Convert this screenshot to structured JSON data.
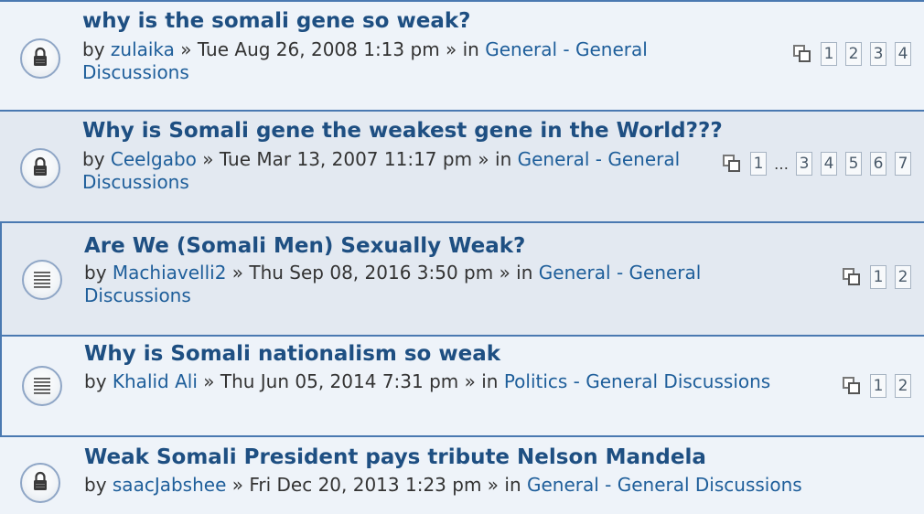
{
  "topics": [
    {
      "title": "why is the somali gene so weak?",
      "by": "by",
      "author": "zulaika",
      "date": "» Tue Aug 26, 2008 1:13 pm » in",
      "forum": "General - General Discussions",
      "icon": "lock-icon",
      "pages": [
        "1",
        "2",
        "3",
        "4"
      ]
    },
    {
      "title": "Why is Somali gene the weakest gene in the World???",
      "by": "by",
      "author": "Ceelgabo",
      "date": "» Tue Mar 13, 2007 11:17 pm » in",
      "forum": "General - General Discussions",
      "icon": "lock-icon",
      "pages": [
        "1",
        "…",
        "3",
        "4",
        "5",
        "6",
        "7"
      ]
    },
    {
      "title": "Are We (Somali Men) Sexually Weak?",
      "by": "by",
      "author": "Machiavelli2",
      "date": "» Thu Sep 08, 2016 3:50 pm » in",
      "forum": "General - General Discussions",
      "icon": "document-icon",
      "pages": [
        "1",
        "2"
      ]
    },
    {
      "title": "Why is Somali nationalism so weak",
      "by": "by",
      "author": "Khalid Ali",
      "date": "» Thu Jun 05, 2014 7:31 pm » in",
      "forum": "Politics - General Discussions",
      "icon": "document-icon",
      "pages": [
        "1",
        "2"
      ]
    },
    {
      "title": "Weak Somali President pays tribute Nelson Mandela",
      "by": "by",
      "author": "saacJabshee",
      "date": "» Fri Dec 20, 2013 1:23 pm » in",
      "forum": "General - General Discussions",
      "icon": "lock-icon",
      "pages": []
    }
  ]
}
